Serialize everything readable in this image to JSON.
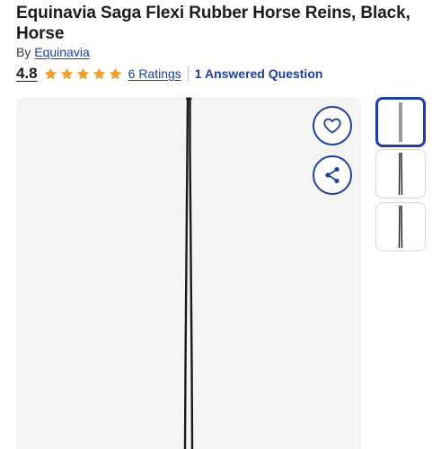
{
  "product": {
    "title": "Equinavia Saga Flexi Rubber Horse Reins, Black, Horse",
    "by_prefix": "By",
    "brand": "Equinavia"
  },
  "rating": {
    "value": "4.8",
    "stars": 5,
    "ratings_link": "6 Ratings",
    "questions_link": "1 Answered Question"
  },
  "actions": {
    "favorite_icon": "heart-icon",
    "share_icon": "share-icon"
  },
  "gallery": {
    "thumbnail_count": 3,
    "active_thumbnail": 1
  },
  "colors": {
    "accent": "#1f3fa3",
    "star": "#f0a030",
    "image_background": "#f4f4f5",
    "product": "#1b1b1b"
  }
}
